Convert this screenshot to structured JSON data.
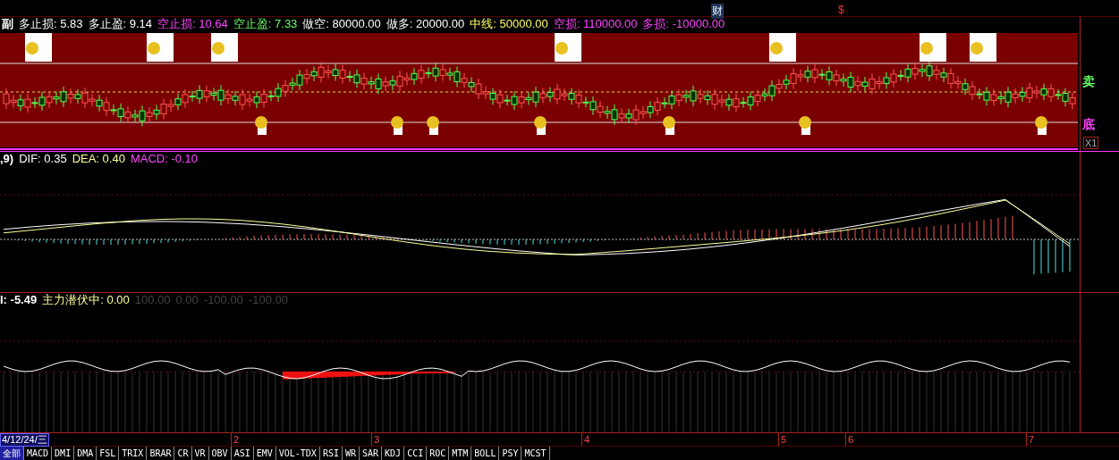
{
  "top_markers": [
    {
      "text": "财",
      "kind": "news"
    },
    {
      "text": "$",
      "kind": "money"
    }
  ],
  "main_panel": {
    "legend": [
      {
        "text": "副",
        "color": "#ffffff"
      },
      {
        "text": "多止损: 5.83",
        "color": "#ffffff"
      },
      {
        "text": "多止盈: 9.14",
        "color": "#ffffff"
      },
      {
        "text": "空止损: 10.64",
        "color": "#ff44ff"
      },
      {
        "text": "空止盈: 7.33",
        "color": "#66ff66"
      },
      {
        "text": "做空: 80000.00",
        "color": "#ffffff"
      },
      {
        "text": "做多: 20000.00",
        "color": "#ffffff"
      },
      {
        "text": "中线: 50000.00",
        "color": "#ffff66"
      },
      {
        "text": "空损: 110000.00",
        "color": "#ff44ff"
      },
      {
        "text": "多损: -10000.00",
        "color": "#ff44ff"
      }
    ],
    "side_labels": [
      {
        "text": "卖",
        "color": "#66ff66"
      },
      {
        "text": "底",
        "color": "#ff44ff"
      }
    ],
    "scale_label": "X1"
  },
  "macd_panel": {
    "legend": [
      {
        "text": ",9)",
        "color": "#ffffff"
      },
      {
        "text": "DIF: 0.35",
        "color": "#ffffff"
      },
      {
        "text": "DEA: 0.40",
        "color": "#ffff99"
      },
      {
        "text": "MACD: -0.10",
        "color": "#ff44ff"
      }
    ]
  },
  "indicator_panel": {
    "legend": [
      {
        "text": "I: -5.49",
        "color": "#ffffff"
      },
      {
        "text": "主力潜伏中: 0.00",
        "color": "#ffff99"
      },
      {
        "text": "100.00",
        "color": "#444444"
      },
      {
        "text": "0.00",
        "color": "#444444"
      },
      {
        "text": "-100.00",
        "color": "#444444"
      },
      {
        "text": "-100.00",
        "color": "#444444"
      }
    ]
  },
  "time_axis": {
    "current_date": "4/12/24/三",
    "labels": [
      "2",
      "3",
      "4",
      "5",
      "6",
      "7"
    ]
  },
  "tabs": [
    {
      "label": "全部",
      "selected": true
    },
    {
      "label": "MACD",
      "selected": false
    },
    {
      "label": "DMI",
      "selected": false
    },
    {
      "label": "DMA",
      "selected": false
    },
    {
      "label": "FSL",
      "selected": false
    },
    {
      "label": "TRIX",
      "selected": false
    },
    {
      "label": "BRAR",
      "selected": false
    },
    {
      "label": "CR",
      "selected": false
    },
    {
      "label": "VR",
      "selected": false
    },
    {
      "label": "OBV",
      "selected": false
    },
    {
      "label": "ASI",
      "selected": false
    },
    {
      "label": "EMV",
      "selected": false
    },
    {
      "label": "VOL-TDX",
      "selected": false
    },
    {
      "label": "RSI",
      "selected": false
    },
    {
      "label": "WR",
      "selected": false
    },
    {
      "label": "SAR",
      "selected": false
    },
    {
      "label": "KDJ",
      "selected": false
    },
    {
      "label": "CCI",
      "selected": false
    },
    {
      "label": "ROC",
      "selected": false
    },
    {
      "label": "MTM",
      "selected": false
    },
    {
      "label": "BOLL",
      "selected": false
    },
    {
      "label": "PSY",
      "selected": false
    },
    {
      "label": "MCST",
      "selected": false
    }
  ]
}
